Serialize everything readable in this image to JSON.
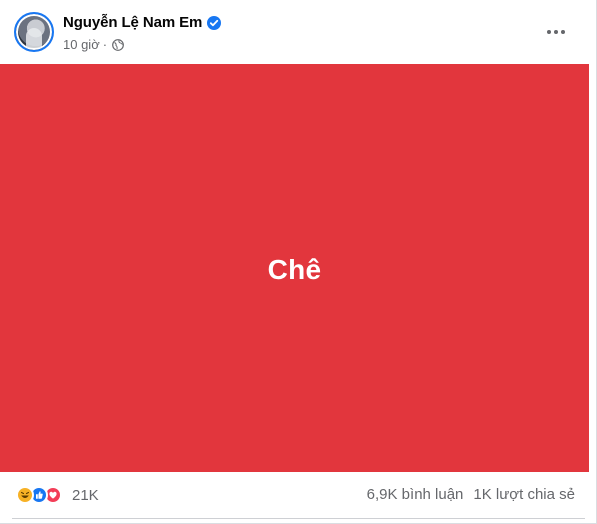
{
  "post": {
    "author_name": "Nguyễn Lệ Nam Em",
    "timestamp": "10 giờ",
    "separator": "·",
    "verified": true,
    "audience_icon": "globe-icon",
    "more_icon": "more-horizontal-icon",
    "media_text": "Chê",
    "media_background": "#e2363d"
  },
  "footer": {
    "reaction_icons": [
      "haha-icon",
      "like-icon",
      "love-icon"
    ],
    "reaction_count": "21K",
    "comments": "6,9K bình luận",
    "shares": "1K lượt chia sẻ"
  },
  "colors": {
    "accent": "#1877f2",
    "secondary_text": "#65676b",
    "love": "#f33e58",
    "haha": "#f7b125"
  }
}
